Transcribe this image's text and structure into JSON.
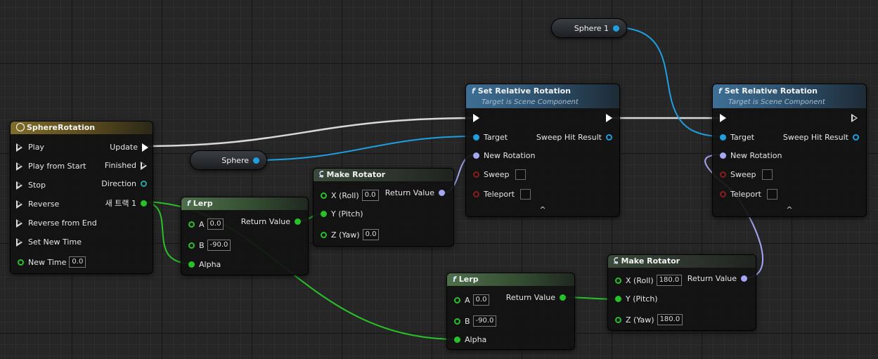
{
  "timeline": {
    "title": "SphereRotation",
    "inputs": [
      "Play",
      "Play from Start",
      "Stop",
      "Reverse",
      "Reverse from End",
      "Set New Time"
    ],
    "new_time_label": "New Time",
    "new_time_value": "0.0",
    "outputs": [
      "Update",
      "Finished",
      "Direction",
      "새 트랙 1"
    ]
  },
  "sphere_var": {
    "label": "Sphere"
  },
  "sphere1_var": {
    "label": "Sphere 1"
  },
  "lerp1": {
    "title": "Lerp",
    "a_label": "A",
    "a_value": "0.0",
    "b_label": "B",
    "b_value": "-90.0",
    "alpha_label": "Alpha",
    "return_label": "Return Value"
  },
  "lerp2": {
    "title": "Lerp",
    "a_label": "A",
    "a_value": "0.0",
    "b_label": "B",
    "b_value": "-90.0",
    "alpha_label": "Alpha",
    "return_label": "Return Value"
  },
  "make_rot1": {
    "title": "Make Rotator",
    "x_label": "X (Roll)",
    "x_value": "0.0",
    "y_label": "Y (Pitch)",
    "z_label": "Z (Yaw)",
    "z_value": "0.0",
    "return_label": "Return Value"
  },
  "make_rot2": {
    "title": "Make Rotator",
    "x_label": "X (Roll)",
    "x_value": "180.0",
    "y_label": "Y (Pitch)",
    "z_label": "Z (Yaw)",
    "z_value": "180.0",
    "return_label": "Return Value"
  },
  "set_rot1": {
    "title": "Set Relative Rotation",
    "subtitle": "Target is Scene Component",
    "target_label": "Target",
    "new_rotation_label": "New Rotation",
    "sweep_label": "Sweep",
    "teleport_label": "Teleport",
    "sweep_hit_label": "Sweep Hit Result",
    "expand": "^"
  },
  "set_rot2": {
    "title": "Set Relative Rotation",
    "subtitle": "Target is Scene Component",
    "target_label": "Target",
    "new_rotation_label": "New Rotation",
    "sweep_label": "Sweep",
    "teleport_label": "Teleport",
    "sweep_hit_label": "Sweep Hit Result",
    "expand": "^"
  },
  "colors": {
    "exec": "#ffffff",
    "float": "#27c227",
    "object": "#1e9fe0",
    "rotator": "#a3a7f5",
    "bool": "#8a1c1c",
    "function_header": "#3e6f95",
    "timeline_header": "#806d28",
    "pure_header": "#4f6f4b"
  }
}
